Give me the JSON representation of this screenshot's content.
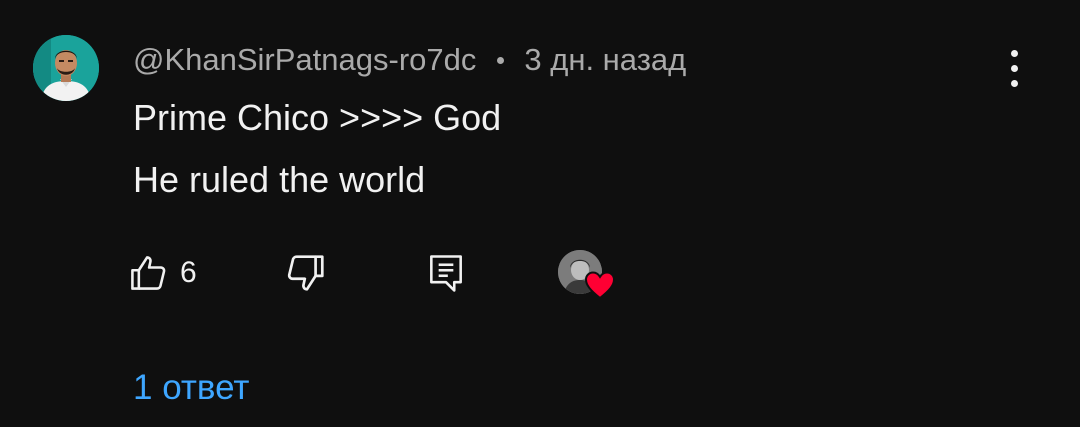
{
  "comment": {
    "author_handle": "@KhanSirPatnags-ro7dc",
    "separator": "•",
    "timestamp": "3 дн. назад",
    "text_lines": [
      "Prime Chico >>>> God",
      "He ruled the world"
    ],
    "like_count": "6",
    "replies_label": "1 ответ",
    "hearted_by_creator": true
  },
  "icons": {
    "like": "thumbs-up-icon",
    "dislike": "thumbs-down-icon",
    "reply": "reply-comment-icon",
    "more": "more-vert-icon",
    "heart": "heart-icon"
  },
  "colors": {
    "background": "#0f0f0f",
    "text_primary": "#f1f1f1",
    "text_secondary": "#aaaaaa",
    "link": "#3ea6ff",
    "heart": "#ff0033",
    "avatar_bg": "#1aa39b"
  }
}
